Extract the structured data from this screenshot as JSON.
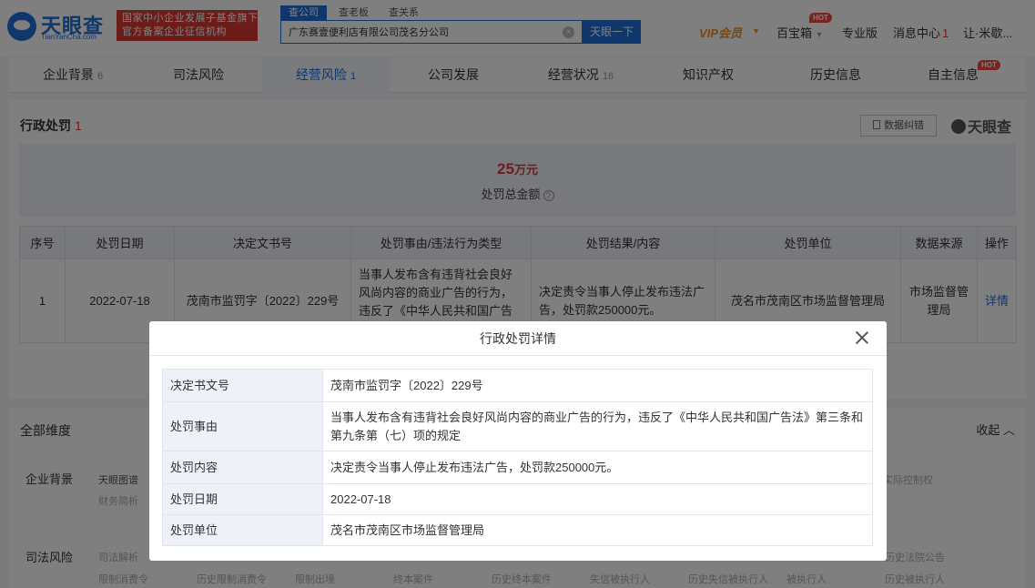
{
  "header": {
    "logo_text": "天眼查",
    "logo_sub": "TianYanCha.com",
    "banner_line1": "国家中小企业发展子基金旗下",
    "banner_line2": "官方备案企业征信机构",
    "search_tabs": [
      "查公司",
      "查老板",
      "查关系"
    ],
    "search_value": "广东赛壹便利店有限公司茂名分公司",
    "clear_glyph": "×",
    "search_button": "天眼一下",
    "vip": "VIP会员",
    "baobao": "百宝箱",
    "hot": "HOT",
    "pro": "专业版",
    "messages": "消息中心",
    "messages_count": "1",
    "user": "让·米歇..."
  },
  "tabs": [
    {
      "label": "企业背景",
      "count": "6"
    },
    {
      "label": "司法风险",
      "count": ""
    },
    {
      "label": "经营风险",
      "count": "1"
    },
    {
      "label": "公司发展",
      "count": ""
    },
    {
      "label": "经营状况",
      "count": "16"
    },
    {
      "label": "知识产权",
      "count": ""
    },
    {
      "label": "历史信息",
      "count": ""
    },
    {
      "label": "自主信息",
      "count": ""
    }
  ],
  "penalty": {
    "title": "行政处罚",
    "count": "1",
    "correction_button": "数据纠错",
    "watermark": "天眼查",
    "total_amount": "25",
    "total_unit": "万元",
    "total_label": "处罚总金额",
    "help_glyph": "?",
    "columns": [
      "序号",
      "处罚日期",
      "决定文书号",
      "处罚事由/违法行为类型",
      "处罚结果/内容",
      "处罚单位",
      "数据来源",
      "操作"
    ],
    "rows": [
      {
        "index": "1",
        "date": "2022-07-18",
        "doc_no": "茂南市监罚字〔2022〕229号",
        "reason": "当事人发布含有违背社会良好风尚内容的商业广告的行为，违反了《中华人民共和国广告法》第三条和第九条第（七）项的规定",
        "result": "决定责令当事人停止发布违法广告，处罚款250000元。",
        "unit": "茂名市茂南区市场监督管理局",
        "source": "市场监督管理局",
        "action": "详情"
      }
    ]
  },
  "dimensions": {
    "title": "全部维度",
    "collapse": "收起",
    "cat1": "企业背景",
    "cat1_items": [
      "天眼图谱",
      "财务简析",
      "实际控制权"
    ],
    "cat2": "司法风险",
    "cat2_items": [
      "司法解析",
      "限制消费令",
      "历史限制消费令",
      "限制出境",
      "终本案件",
      "历史终本案件",
      "失信被执行人",
      "历史失信被执行人",
      "被执行人",
      "历史被执行人",
      "历史法院公告"
    ]
  },
  "modal": {
    "title": "行政处罚详情",
    "rows": [
      {
        "key": "决定书文号",
        "value": "茂南市监罚字〔2022〕229号"
      },
      {
        "key": "处罚事由",
        "value": "当事人发布含有违背社会良好风尚内容的商业广告的行为，违反了《中华人民共和国广告法》第三条和第九条第（七）项的规定"
      },
      {
        "key": "处罚内容",
        "value": "决定责令当事人停止发布违法广告，处罚款250000元。"
      },
      {
        "key": "处罚日期",
        "value": "2022-07-18"
      },
      {
        "key": "处罚单位",
        "value": "茂名市茂南区市场监督管理局"
      }
    ]
  },
  "colors": {
    "accent": "#1e6fd6",
    "danger": "#e03a3a",
    "vip": "#e8911e",
    "banner": "#d93a34"
  }
}
